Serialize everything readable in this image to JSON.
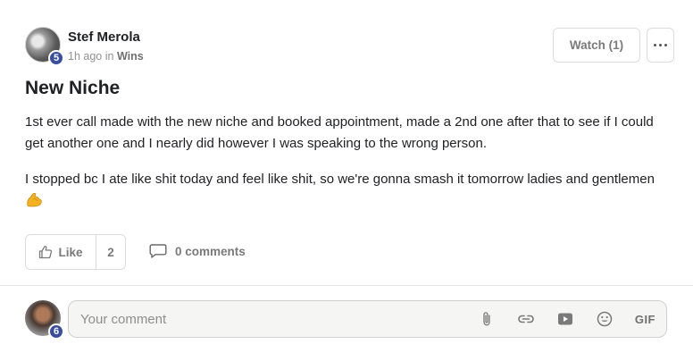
{
  "post": {
    "author": {
      "name": "Stef Merola",
      "level": "5"
    },
    "meta": {
      "time": "1h ago",
      "in_word": "in",
      "category": "Wins"
    },
    "watch_label": "Watch (1)",
    "title": "New Niche",
    "body": {
      "paragraph_1": "1st ever call made with the new niche and booked appointment, made a 2nd one after that to see if I could get another one and I nearly did however I was speaking to the wrong person.",
      "paragraph_2": "I stopped bc I ate like shit today and feel like shit, so we're gonna smash it tomorrow ladies and gentlemen",
      "emoji": "flexed-biceps"
    },
    "like_label": "Like",
    "like_count": "2",
    "comments_label": "0 comments"
  },
  "comment_composer": {
    "user_level": "6",
    "placeholder": "Your comment",
    "value": "",
    "tools": [
      "paperclip-icon",
      "link-icon",
      "video-icon",
      "emoji-icon",
      "gif"
    ],
    "gif_label": "GIF"
  },
  "colors": {
    "level_badge": "#3a4ea0",
    "muted_text": "#7a7a7a",
    "border": "#dcdcdc",
    "composer_bg": "#f5f5f4"
  }
}
